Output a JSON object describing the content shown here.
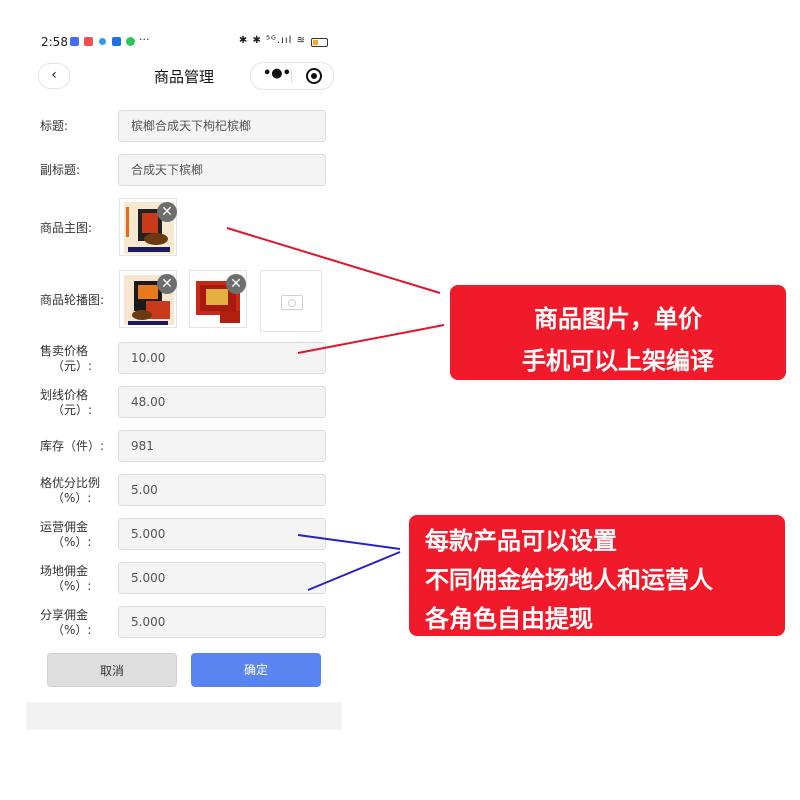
{
  "status_bar": {
    "time": "2:58",
    "right_icons": "✱ ✱ ⁵ᴳ.ııl ≋",
    "battery_level": 0.35
  },
  "nav": {
    "back_icon": "‹",
    "title": "商品管理",
    "more_icon": "•●•"
  },
  "form": {
    "title": {
      "label": "标题:",
      "value": "槟榔合成天下枸杞槟榔"
    },
    "subtitle": {
      "label": "副标题:",
      "value": "合成天下槟榔"
    },
    "main_image": {
      "label": "商品主图:"
    },
    "carousel": {
      "label": "商品轮播图:"
    },
    "sale_price": {
      "label_1": "售卖价格",
      "label_2": "（元）:",
      "value": "10.00"
    },
    "list_price": {
      "label_1": "划线价格",
      "label_2": "（元）:",
      "value": "48.00"
    },
    "stock": {
      "label": "库存（件）:",
      "value": "981"
    },
    "discount_ratio": {
      "label_1": "格优分比例",
      "label_2": "（%）:",
      "value": "5.00"
    },
    "ops_commission": {
      "label_1": "运营佣金",
      "label_2": "（%）:",
      "value": "5.000"
    },
    "venue_commission": {
      "label_1": "场地佣金",
      "label_2": "（%）:",
      "value": "5.000"
    },
    "share_commission": {
      "label_1": "分享佣金",
      "label_2": "（%）:",
      "value": "5.000"
    }
  },
  "buttons": {
    "cancel": "取消",
    "confirm": "确定"
  },
  "delete_icon": "✕",
  "annotations": {
    "callout1": {
      "line1": "商品图片，单价",
      "line2": "手机可以上架编译",
      "color": "#f01a2a"
    },
    "callout2": {
      "line1": "每款产品可以设置",
      "line2": "不同佣金给场地人和运营人",
      "line3": "各角色自由提现",
      "color": "#f01a2a"
    },
    "line1_color": "#e3142a",
    "line2_color": "#2b20c8"
  },
  "colors": {
    "confirm_button": "#5a85f0",
    "cancel_button": "#dedede",
    "input_bg": "#f4f4f4"
  }
}
